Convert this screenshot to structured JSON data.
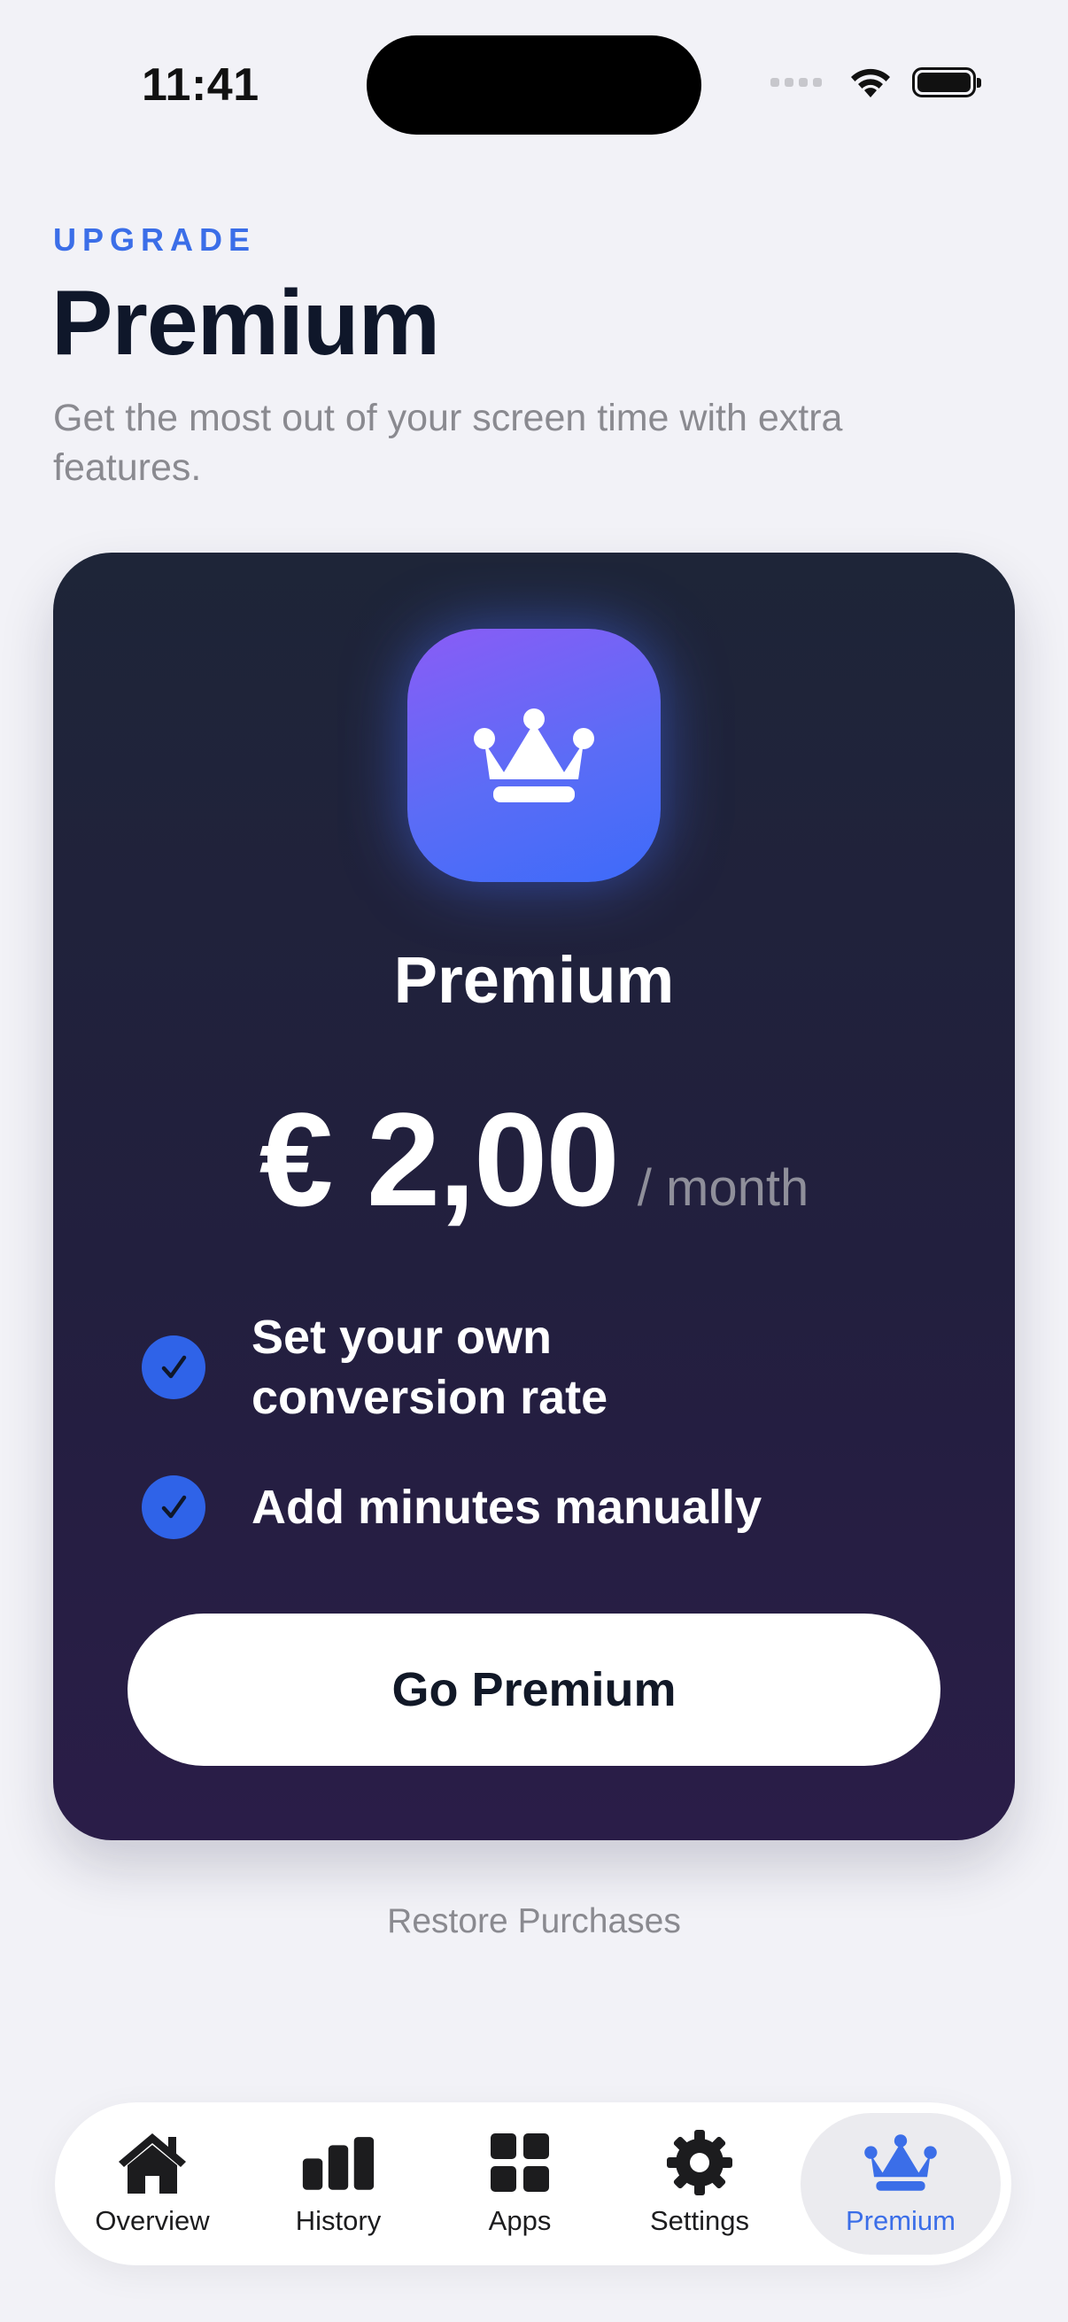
{
  "status_bar": {
    "time": "11:41"
  },
  "header": {
    "eyebrow": "UPGRADE",
    "title": "Premium",
    "subtitle": "Get the most out of your screen time with extra features."
  },
  "card": {
    "icon": "crown-icon",
    "title": "Premium",
    "price": "€ 2,00",
    "period": "/ month",
    "features": [
      {
        "icon": "checkmark-circle-icon",
        "text": "Set your own conversion rate"
      },
      {
        "icon": "checkmark-circle-icon",
        "text": "Add minutes manually"
      }
    ],
    "cta_label": "Go Premium"
  },
  "restore_label": "Restore Purchases",
  "tab_bar": {
    "items": [
      {
        "label": "Overview",
        "icon": "house-icon"
      },
      {
        "label": "History",
        "icon": "bar-chart-icon"
      },
      {
        "label": "Apps",
        "icon": "grid-icon"
      },
      {
        "label": "Settings",
        "icon": "gear-icon"
      },
      {
        "label": "Premium",
        "icon": "crown-icon"
      }
    ],
    "active": "Premium"
  },
  "colors": {
    "accent": "#3b6ee8",
    "background": "#f2f2f7",
    "card_top": "#1e2538",
    "card_bottom": "#2a1d48"
  }
}
